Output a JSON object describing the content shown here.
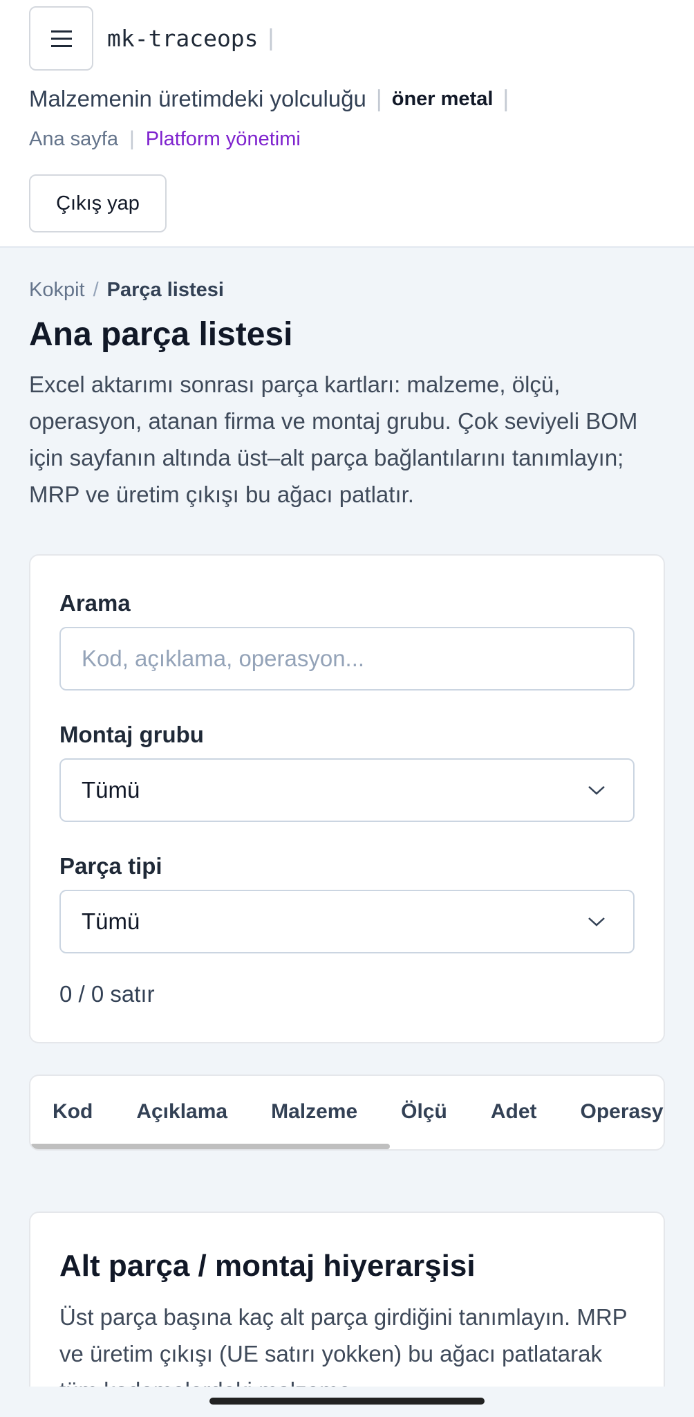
{
  "header": {
    "brand": "mk-traceops",
    "tagline": "Malzemenin üretimdeki yolculuğu",
    "company": "öner metal",
    "nav": {
      "home": "Ana sayfa",
      "admin": "Platform yönetimi"
    },
    "logout_label": "Çıkış yap"
  },
  "breadcrumb": {
    "parent": "Kokpit",
    "current": "Parça listesi"
  },
  "page": {
    "title": "Ana parça listesi",
    "intro": "Excel aktarımı sonrası parça kartları: malzeme, ölçü, operasyon, atanan firma ve montaj grubu. Çok seviyeli BOM için sayfanın altında üst–alt parça bağlantılarını tanımlayın; MRP ve üretim çıkışı bu ağacı patlatır."
  },
  "filters": {
    "search_label": "Arama",
    "search_placeholder": "Kod, açıklama, operasyon...",
    "assembly_label": "Montaj grubu",
    "assembly_value": "Tümü",
    "type_label": "Parça tipi",
    "type_value": "Tümü",
    "row_count": "0 / 0 satır"
  },
  "table": {
    "columns": [
      "Kod",
      "Açıklama",
      "Malzeme",
      "Ölçü",
      "Adet",
      "Operasyon"
    ],
    "rows": []
  },
  "hierarchy": {
    "title": "Alt parça / montaj hiyerarşisi",
    "text": "Üst parça başına kaç alt parça girdiğini tanımlayın. MRP ve üretim çıkışı (UE satırı yokken) bu ağacı patlatarak tüm kademelerdeki malzeme"
  },
  "icons": {
    "menu": "hamburger-menu-icon",
    "select": "chevron-down-icon"
  }
}
